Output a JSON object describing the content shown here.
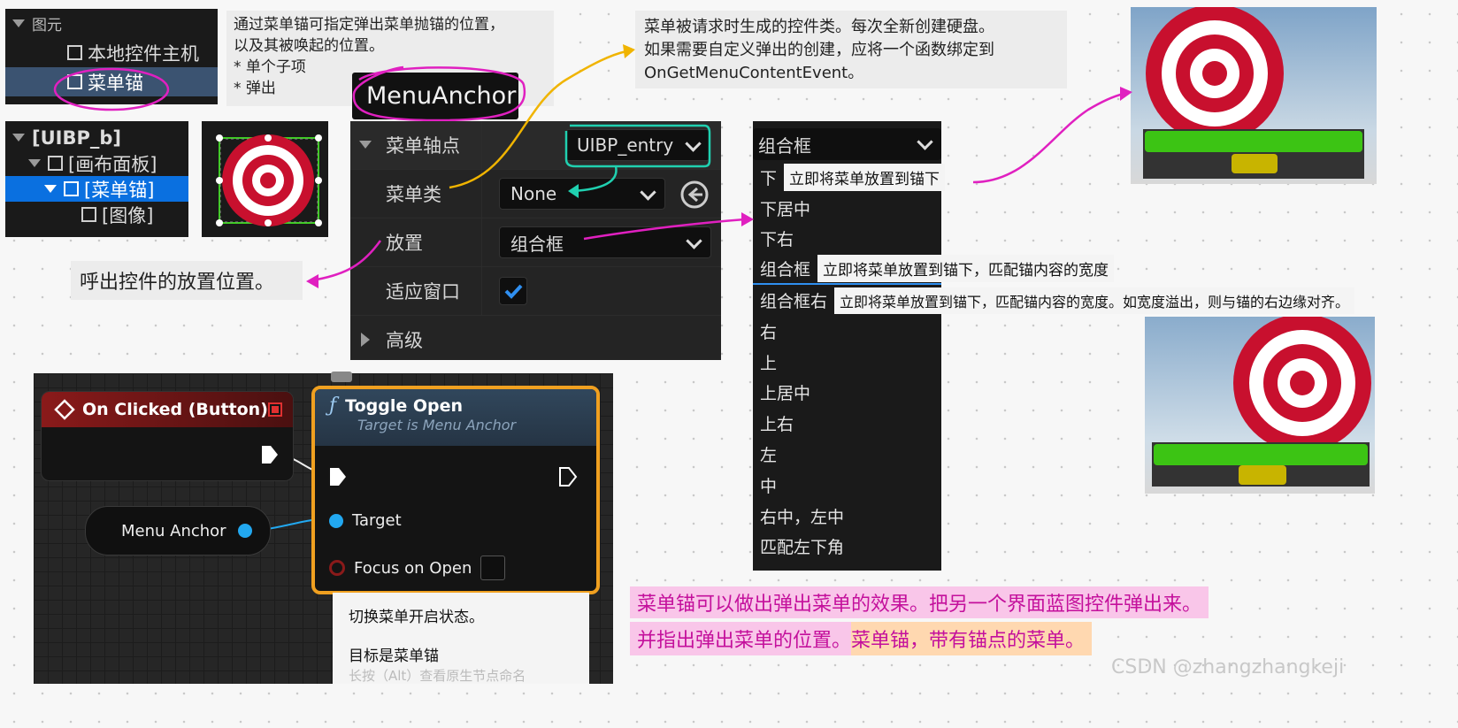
{
  "hierarchy_top": {
    "root_label": "图元",
    "items": [
      "本地控件主机",
      "菜单锚"
    ]
  },
  "note_top_left": {
    "line1": "通过菜单锚可指定弹出菜单抛锚的位置，",
    "line2": "以及其被唤起的位置。",
    "bullet1": "* 单个子项",
    "bullet2": "* 弹出"
  },
  "widget_name": "MenuAnchor",
  "hierarchy_tree": {
    "items": [
      "[UIBP_b]",
      "[画布面板]",
      "[菜单锚]",
      "[图像]"
    ]
  },
  "details": {
    "rows": [
      {
        "label": "菜单轴点",
        "value": "UIBP_entry"
      },
      {
        "label": "菜单类",
        "value": "None"
      },
      {
        "label": "放置",
        "value": "组合框"
      },
      {
        "label": "适应窗口",
        "value": ""
      }
    ],
    "advanced_label": "高级",
    "fit_in_window_checked": true
  },
  "note_class": {
    "line1": "菜单被请求时生成的控件类。每次全新创建硬盘。",
    "line2": "如果需要自定义弹出的创建，应将一个函数绑定到",
    "line3": "OnGetMenuContentEvent。"
  },
  "note_placement": "呼出控件的放置位置。",
  "dropdown": {
    "selected": "组合框",
    "options": [
      "下",
      "下居中",
      "下右",
      "组合框",
      "组合框右",
      "右",
      "上",
      "上居中",
      "上右",
      "左",
      "中",
      "右中，左中",
      "匹配左下角"
    ],
    "tip_below": "立即将菜单放置到锚下",
    "tip_combo": "立即将菜单放置到锚下，匹配锚内容的宽度",
    "tip_combo_right": "立即将菜单放置到锚下，匹配锚内容的宽度。如宽度溢出，则与锚的右边缘对齐。"
  },
  "blueprint": {
    "event_title": "On Clicked (Button)",
    "func_title": "Toggle Open",
    "func_subtitle": "Target is Menu Anchor",
    "var_label": "Menu Anchor",
    "pin_target": "Target",
    "pin_focus": "Focus on Open",
    "tooltip_line1": "切换菜单开启状态。",
    "tooltip_line2": "目标是菜单锚",
    "tooltip_line3": "长按（Alt）查看原生节点命名"
  },
  "summary": {
    "line1": "菜单锚可以做出弹出菜单的效果。把另一个界面蓝图控件弹出来。",
    "line2a": "并指出弹出菜单的位置。",
    "line2b": "菜单锚，带有锚点的菜单。"
  },
  "watermark": "CSDN @zhangzhangkeji",
  "colors": {
    "annotation_pink": "#e020c0",
    "annotation_orange": "#f0b400",
    "annotation_teal": "#20d0b0",
    "selection_blue": "#0a70e0",
    "exec_red": "#8a1a1a",
    "func_orange": "#f0a020",
    "pin_blue": "#22a8f0",
    "check_blue": "#2f8ff0",
    "bar_green": "#3cc414"
  }
}
